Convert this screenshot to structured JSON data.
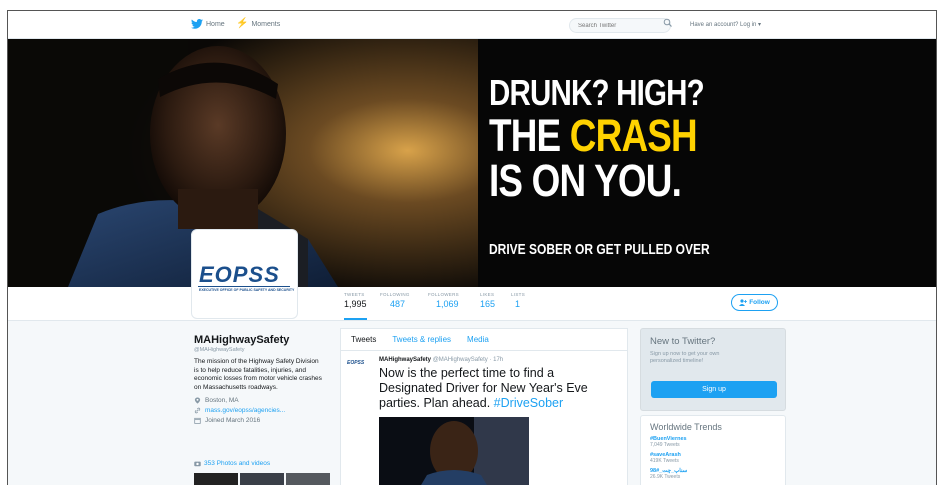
{
  "nav": {
    "home": "Home",
    "moments": "Moments",
    "search_placeholder": "Search Twitter",
    "login": "Have an account? Log in ▾"
  },
  "banner": {
    "line1": "DRUNK? HIGH?",
    "line2a": "THE ",
    "line2b": "CRASH",
    "line3": "IS ON YOU.",
    "tagline": "DRIVE SOBER OR GET PULLED OVER"
  },
  "avatar": {
    "logo": "EOPSS",
    "tagline": "EXECUTIVE OFFICE OF PUBLIC SAFETY AND SECURITY"
  },
  "stats": [
    {
      "label": "TWEETS",
      "value": "1,995"
    },
    {
      "label": "FOLLOWING",
      "value": "487"
    },
    {
      "label": "FOLLOWERS",
      "value": "1,069"
    },
    {
      "label": "LIKES",
      "value": "165"
    },
    {
      "label": "LISTS",
      "value": "1"
    }
  ],
  "follow_label": "Follow",
  "profile": {
    "name": "MAHighwaySafety",
    "handle": "@MAHighwaySafety",
    "bio": "The mission of the Highway Safety Division is to help reduce fatalities, injuries, and economic losses from motor vehicle crashes on Massachusetts roadways.",
    "location": "Boston, MA",
    "website": "mass.gov/eopss/agencies...",
    "joined": "Joined March 2016",
    "photos": "353 Photos and videos"
  },
  "tabs": [
    {
      "label": "Tweets"
    },
    {
      "label": "Tweets & replies"
    },
    {
      "label": "Media"
    }
  ],
  "tweet": {
    "avatar": "EOPSS",
    "name": "MAHighwaySafety",
    "handle": "@MAHighwaySafety · 17h",
    "text": "Now is the perfect time to find a Designated Driver for New Year's Eve parties. Plan ahead. ",
    "hashtag": "#DriveSober"
  },
  "new_to_twitter": {
    "title": "New to Twitter?",
    "subtitle": "Sign up now to get your own personalized timeline!",
    "button": "Sign up"
  },
  "trends": {
    "title": "Worldwide Trends",
    "items": [
      {
        "name": "#BuenViernes",
        "count": "7,049 Tweets"
      },
      {
        "name": "#saveArash",
        "count": "419K Tweets"
      },
      {
        "name": "سناپ_چت_#98",
        "count": "26.9K Tweets"
      }
    ]
  },
  "colors": {
    "accent": "#1da1f2",
    "highlight": "#ffd200",
    "brand": "#1b4f8c"
  }
}
